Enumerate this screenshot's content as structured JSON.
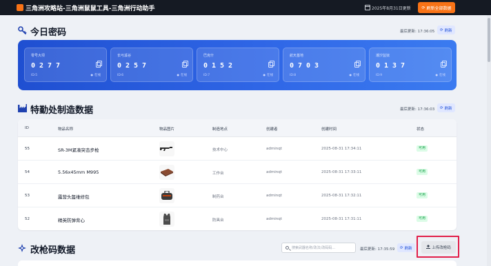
{
  "topbar": {
    "title": "三角洲攻略站-三角洲鼠鼠工具-三角洲行动助手",
    "update_date": "2025年8月31日更新",
    "refresh_all_label": "刷新全部数据",
    "refresh_icon": "⟳"
  },
  "passwords": {
    "title": "今日密码",
    "icon": "key-icon",
    "updated": "最后更新: 17:36:05",
    "refresh_label": "刷新",
    "cards": [
      {
        "name": "零号大坝",
        "code": "0277",
        "id": "ID:5",
        "status": "在线"
      },
      {
        "name": "长弓溪谷",
        "code": "0257",
        "id": "ID:6",
        "status": "在线"
      },
      {
        "name": "巴克什",
        "code": "0152",
        "id": "ID:7",
        "status": "在线"
      },
      {
        "name": "航天基地",
        "code": "0703",
        "id": "ID:8",
        "status": "在线"
      },
      {
        "name": "潮汐监狱",
        "code": "0137",
        "id": "ID:9",
        "status": "在线"
      }
    ]
  },
  "manufacturing": {
    "title": "特勤处制造数据",
    "icon": "factory-icon",
    "updated": "最后更新: 17:36:03",
    "refresh_label": "刷新",
    "columns": [
      "ID",
      "物品名称",
      "物品图片",
      "制造地点",
      "创建者",
      "创建时间",
      "状态"
    ],
    "rows": [
      {
        "id": "55",
        "name": "SR-3M紧凑突击步枪",
        "location": "技术中心",
        "creator": "adminqt",
        "time": "2025-08-31 17:34:11",
        "status": "可用",
        "image": "rifle-icon"
      },
      {
        "id": "54",
        "name": "5.56x45mm M995",
        "location": "工作台",
        "creator": "adminqt",
        "time": "2025-08-31 17:33:11",
        "status": "可用",
        "image": "ammo-box-icon"
      },
      {
        "id": "53",
        "name": "露营头盔维修包",
        "location": "制药台",
        "creator": "adminqt",
        "time": "2025-08-31 17:32:11",
        "status": "可用",
        "image": "repair-kit-icon"
      },
      {
        "id": "52",
        "name": "精英防弹背心",
        "location": "防具台",
        "creator": "adminqt",
        "time": "2025-08-31 17:31:11",
        "status": "可用",
        "image": "vest-icon"
      }
    ]
  },
  "gun_codes": {
    "title": "改枪码数据",
    "icon": "crosshair-icon",
    "search_placeholder": "搜索武器名称/改法/改码码...",
    "updated": "最后更新: 17:35:59",
    "refresh_label": "刷新",
    "upload_label": "上传改枪码",
    "upload_icon": "upload-icon"
  },
  "colors": {
    "accent_orange": "#f97316",
    "panel_blue": "#2f66e6",
    "status_green": "#16a34a",
    "highlight_red": "#e11d48"
  }
}
